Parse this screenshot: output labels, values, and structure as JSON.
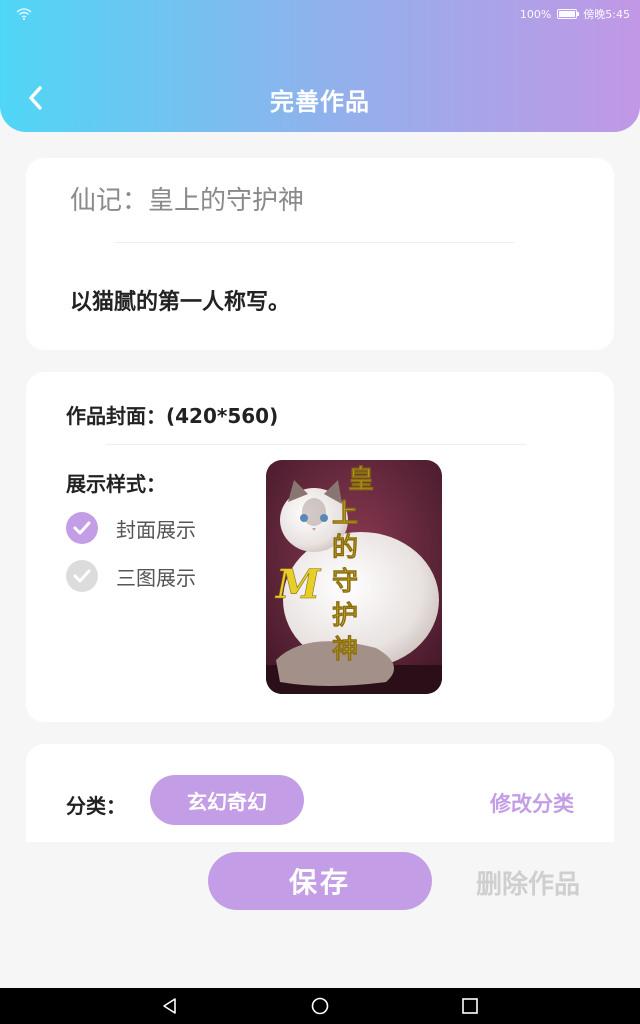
{
  "status_bar": {
    "battery": "100%",
    "time": "傍晚5:45"
  },
  "header": {
    "title": "完善作品"
  },
  "work": {
    "title": "仙记：皇上的守护神",
    "description": "以猫腻的第一人称写。"
  },
  "cover": {
    "label": "作品封面：(420*560)",
    "style_label": "展示样式：",
    "options": [
      {
        "label": "封面展示",
        "checked": true
      },
      {
        "label": "三图展示",
        "checked": false
      }
    ],
    "image_text": "皇上的守护神",
    "image_letter": "M"
  },
  "category": {
    "label": "分类：",
    "value": "玄幻奇幻",
    "modify_label": "修改分类"
  },
  "actions": {
    "save_label": "保存",
    "delete_label": "删除作品"
  },
  "colors": {
    "accent": "#c39ee6",
    "header_start": "#4fd6f6",
    "header_end": "#c197e6"
  }
}
